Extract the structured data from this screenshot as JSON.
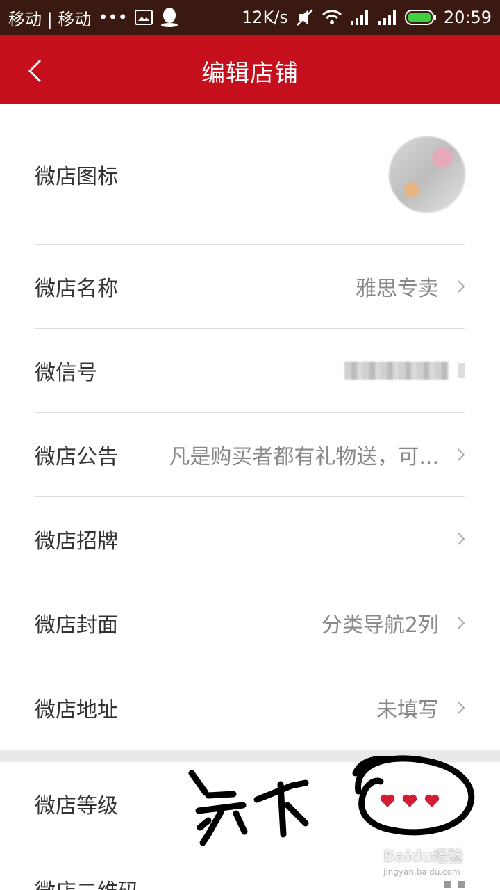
{
  "status_bar": {
    "carrier": "移动 | 移动",
    "dots": "•••",
    "net_speed": "12K/s",
    "time": "20:59"
  },
  "header": {
    "title": "编辑店铺"
  },
  "rows": {
    "shop_icon": {
      "label": "微店图标"
    },
    "shop_name": {
      "label": "微店名称",
      "value": "雅思专卖"
    },
    "wechat_id": {
      "label": "微信号"
    },
    "announcement": {
      "label": "微店公告",
      "value": "凡是购买者都有礼物送，可..."
    },
    "signboard": {
      "label": "微店招牌"
    },
    "cover": {
      "label": "微店封面",
      "value": "分类导航2列"
    },
    "address": {
      "label": "微店地址",
      "value": "未填写"
    },
    "level": {
      "label": "微店等级",
      "hearts": 3
    },
    "qrcode": {
      "label": "微店二维码"
    }
  },
  "colors": {
    "header_bg": "#c50f1c",
    "heart": "#d21d34"
  },
  "watermark": {
    "brand": "Baidu经验",
    "url": "jingyan.baidu.com"
  }
}
